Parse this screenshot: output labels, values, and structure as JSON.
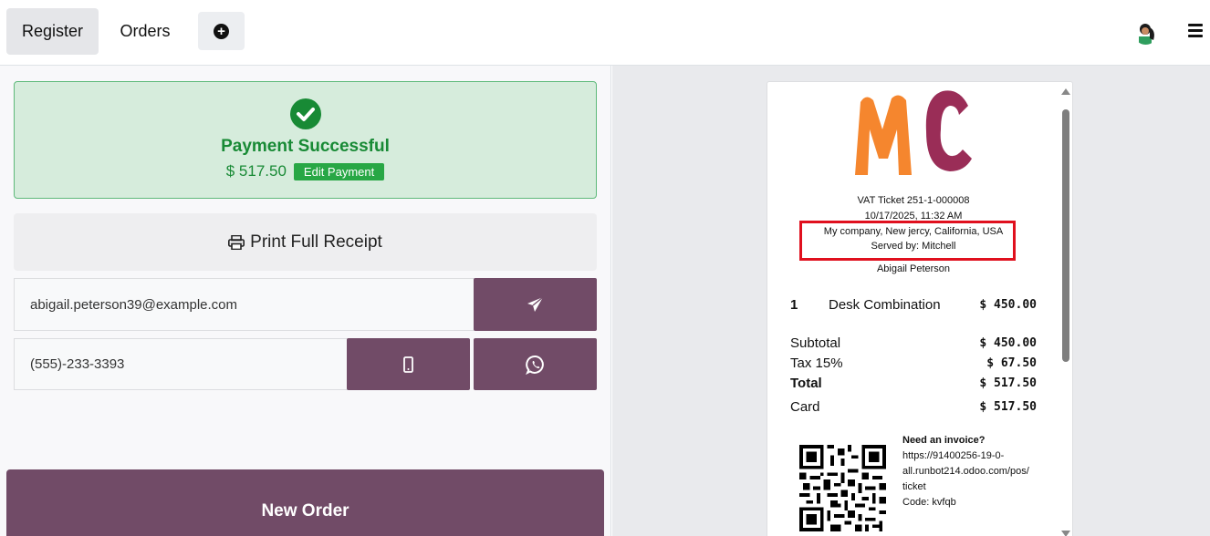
{
  "topbar": {
    "register_label": "Register",
    "orders_label": "Orders"
  },
  "payment": {
    "title": "Payment Successful",
    "amount": "$ 517.50",
    "edit_label": "Edit Payment"
  },
  "print_receipt_label": "Print Full Receipt",
  "email_value": "abigail.peterson39@example.com",
  "phone_value": "(555)-233-3393",
  "new_order_label": "New Order",
  "receipt": {
    "ticket": "VAT Ticket 251-1-000008",
    "datetime": "10/17/2025, 11:32 AM",
    "company": "My company, New jercy, California, USA",
    "served_by": "Served by: Mitchell",
    "customer": "Abigail Peterson",
    "item": {
      "qty": "1",
      "name": "Desk Combination",
      "price": "$ 450.00"
    },
    "subtotal_label": "Subtotal",
    "subtotal": "$ 450.00",
    "tax_label": "Tax 15%",
    "tax": "$ 67.50",
    "total_label": "Total",
    "total": "$ 517.50",
    "card_label": "Card",
    "card": "$ 517.50",
    "invoice_heading": "Need an invoice?",
    "invoice_url_1": "https://91400256-19-0-",
    "invoice_url_2": "all.runbot214.odoo.com/pos/",
    "invoice_url_3": "ticket",
    "invoice_code": "Code: kvfqb"
  },
  "colors": {
    "brand": "#714b67",
    "success": "#188a35",
    "success_bg": "#d6ecdc",
    "highlight": "#e0101e"
  }
}
